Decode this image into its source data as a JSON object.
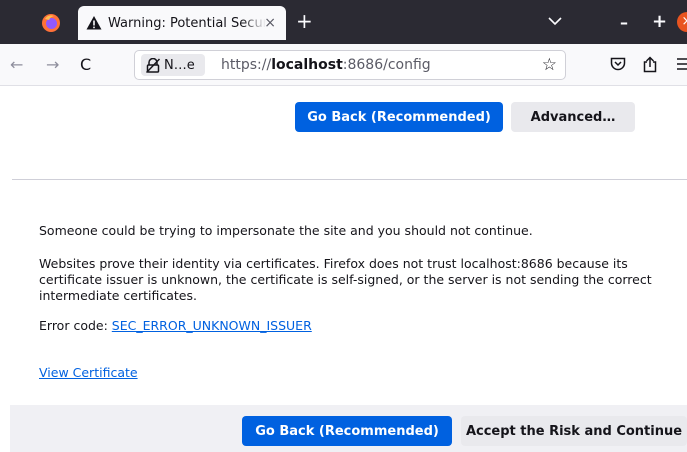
{
  "browser": {
    "tab_title": "Warning: Potential Security Risk Ahead",
    "tab_close": "×",
    "new_tab": "+",
    "window": {
      "minimize": "–",
      "maximize": "+",
      "close": "×"
    }
  },
  "navbar": {
    "back": "←",
    "forward": "→",
    "reload": "C",
    "identity_label": "N…e",
    "url_scheme": "https://",
    "url_host": "localhost",
    "url_rest": ":8686/config",
    "bookmark": "☆"
  },
  "top_buttons": {
    "go_back": "Go Back (Recommended)",
    "advanced": "Advanced…"
  },
  "advanced_panel": {
    "line1": "Someone could be trying to impersonate the site and you should not continue.",
    "line2": "Websites prove their identity via certificates. Firefox does not trust localhost:8686 because its certificate issuer is unknown, the certificate is self-signed, or the server is not sending the correct intermediate certificates.",
    "error_prefix": "Error code: ",
    "error_code": "SEC_ERROR_UNKNOWN_ISSUER",
    "view_certificate": "View Certificate"
  },
  "bottom_buttons": {
    "go_back": "Go Back (Recommended)",
    "accept": "Accept the Risk and Continue"
  },
  "colors": {
    "accent": "#0061e0",
    "tabbar_bg": "#2b2a33",
    "warning_icon": "#15141a",
    "secondary_button": "#e9e9ed"
  },
  "icons": {
    "firefox": "firefox-logo-icon",
    "warning": "warning-triangle-icon",
    "identity": "insecure-lock-icon",
    "pocket": "pocket-icon",
    "share": "share-icon",
    "menu": "hamburger-menu-icon",
    "tab_list": "chevron-down-icon"
  }
}
